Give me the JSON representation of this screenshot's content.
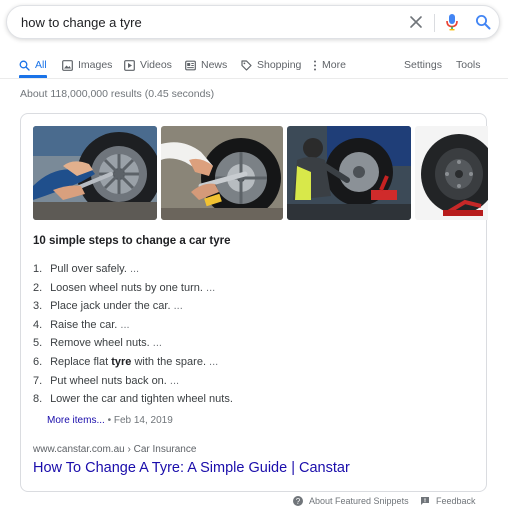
{
  "search": {
    "query": "how to change a tyre"
  },
  "tabs": [
    {
      "label": "All",
      "icon": "search-icon",
      "active": true
    },
    {
      "label": "Images",
      "icon": "image-icon"
    },
    {
      "label": "Videos",
      "icon": "video-icon"
    },
    {
      "label": "News",
      "icon": "news-icon"
    },
    {
      "label": "Shopping",
      "icon": "tag-icon"
    },
    {
      "label": "More",
      "icon": "more-vert-icon"
    },
    {
      "label": "Settings"
    },
    {
      "label": "Tools"
    }
  ],
  "result_stats": "About 118,000,000 results (0.45 seconds)",
  "snippet": {
    "title": "10 simple steps to change a car tyre",
    "steps": [
      {
        "num": "1.",
        "pre": "Pull over safely.",
        "bold": "",
        "post": "",
        "ellipsis": " ..."
      },
      {
        "num": "2.",
        "pre": "Loosen wheel nuts by one turn.",
        "bold": "",
        "post": "",
        "ellipsis": " ..."
      },
      {
        "num": "3.",
        "pre": "Place jack under the car.",
        "bold": "",
        "post": "",
        "ellipsis": " ..."
      },
      {
        "num": "4.",
        "pre": "Raise the car.",
        "bold": "",
        "post": "",
        "ellipsis": " ..."
      },
      {
        "num": "5.",
        "pre": "Remove wheel nuts.",
        "bold": "",
        "post": "",
        "ellipsis": " ..."
      },
      {
        "num": "6.",
        "pre": "Replace flat ",
        "bold": "tyre",
        "post": " with the spare.",
        "ellipsis": " ..."
      },
      {
        "num": "7.",
        "pre": "Put wheel nuts back on.",
        "bold": "",
        "post": "",
        "ellipsis": " ..."
      },
      {
        "num": "8.",
        "pre": "Lower the car and tighten wheel nuts.",
        "bold": "",
        "post": "",
        "ellipsis": ""
      }
    ],
    "more_items": "More items...",
    "date_sep": " • ",
    "date": "Feb 14, 2019",
    "source_url": "www.canstar.com.au › Car Insurance",
    "link_title": "How To Change A Tyre: A Simple Guide | Canstar"
  },
  "footer": {
    "about": "About Featured Snippets",
    "feedback": "Feedback"
  },
  "colors": {
    "link": "#1a0dab",
    "accent": "#1a73e8",
    "mic_blue": "#4285f4",
    "mic_red": "#ea4335"
  }
}
